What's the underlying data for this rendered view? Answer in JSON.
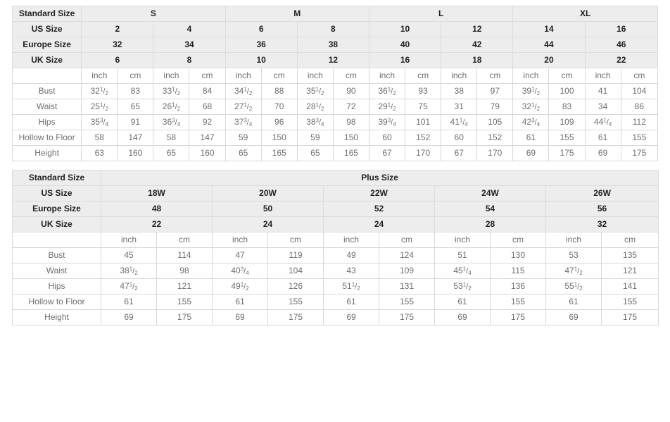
{
  "standard_table": {
    "labels": {
      "standard_size": "Standard Size",
      "us_size": "US Size",
      "europe_size": "Europe Size",
      "uk_size": "UK Size",
      "inch": "inch",
      "cm": "cm"
    },
    "size_groups": [
      "S",
      "M",
      "L",
      "XL"
    ],
    "us_sizes": [
      "2",
      "4",
      "6",
      "8",
      "10",
      "12",
      "14",
      "16"
    ],
    "europe_sizes": [
      "32",
      "34",
      "36",
      "38",
      "40",
      "42",
      "44",
      "46"
    ],
    "uk_sizes": [
      "6",
      "8",
      "10",
      "12",
      "16",
      "18",
      "20",
      "22"
    ],
    "measurements": [
      {
        "name": "Bust",
        "inch": [
          "32 1/2",
          "33 1/2",
          "34 1/2",
          "35 1/2",
          "36 1/2",
          "38",
          "39 1/2",
          "41"
        ],
        "cm": [
          "83",
          "84",
          "88",
          "90",
          "93",
          "97",
          "100",
          "104"
        ]
      },
      {
        "name": "Waist",
        "inch": [
          "25 1/2",
          "26 1/2",
          "27 1/2",
          "28 1/2",
          "29 1/2",
          "31",
          "32 1/2",
          "34"
        ],
        "cm": [
          "65",
          "68",
          "70",
          "72",
          "75",
          "79",
          "83",
          "86"
        ]
      },
      {
        "name": "Hips",
        "inch": [
          "35 3/4",
          "36 3/4",
          "37 3/4",
          "38 3/4",
          "39 3/4",
          "41 1/4",
          "42 3/4",
          "44 1/4"
        ],
        "cm": [
          "91",
          "92",
          "96",
          "98",
          "101",
          "105",
          "109",
          "112"
        ]
      },
      {
        "name": "Hollow to Floor",
        "inch": [
          "58",
          "58",
          "59",
          "59",
          "60",
          "60",
          "61",
          "61"
        ],
        "cm": [
          "147",
          "147",
          "150",
          "150",
          "152",
          "152",
          "155",
          "155"
        ]
      },
      {
        "name": "Height",
        "inch": [
          "63",
          "65",
          "65",
          "65",
          "67",
          "67",
          "69",
          "69"
        ],
        "cm": [
          "160",
          "160",
          "165",
          "165",
          "170",
          "170",
          "175",
          "175"
        ]
      }
    ]
  },
  "plus_table": {
    "labels": {
      "standard_size": "Standard Size",
      "plus_size": "Plus Size",
      "us_size": "US Size",
      "europe_size": "Europe Size",
      "uk_size": "UK Size",
      "inch": "inch",
      "cm": "cm"
    },
    "us_sizes": [
      "18W",
      "20W",
      "22W",
      "24W",
      "26W"
    ],
    "europe_sizes": [
      "48",
      "50",
      "52",
      "54",
      "56"
    ],
    "uk_sizes": [
      "22",
      "24",
      "24",
      "28",
      "32"
    ],
    "measurements": [
      {
        "name": "Bust",
        "inch": [
          "45",
          "47",
          "49",
          "51",
          "53"
        ],
        "cm": [
          "114",
          "119",
          "124",
          "130",
          "135"
        ]
      },
      {
        "name": "Waist",
        "inch": [
          "38 1/2",
          "40 3/4",
          "43",
          "45 1/4",
          "47 1/2"
        ],
        "cm": [
          "98",
          "104",
          "109",
          "115",
          "121"
        ]
      },
      {
        "name": "Hips",
        "inch": [
          "47 1/2",
          "49 1/2",
          "51 1/2",
          "53 1/2",
          "55 1/2"
        ],
        "cm": [
          "121",
          "126",
          "131",
          "136",
          "141"
        ]
      },
      {
        "name": "Hollow to Floor",
        "inch": [
          "61",
          "61",
          "61",
          "61",
          "61"
        ],
        "cm": [
          "155",
          "155",
          "155",
          "155",
          "155"
        ]
      },
      {
        "name": "Height",
        "inch": [
          "69",
          "69",
          "69",
          "69",
          "69"
        ],
        "cm": [
          "175",
          "175",
          "175",
          "175",
          "175"
        ]
      }
    ]
  },
  "colors": {
    "header_bg": "#ededed",
    "border": "#d8d8d8",
    "header_text": "#222222",
    "body_text": "#6e6e6e"
  }
}
